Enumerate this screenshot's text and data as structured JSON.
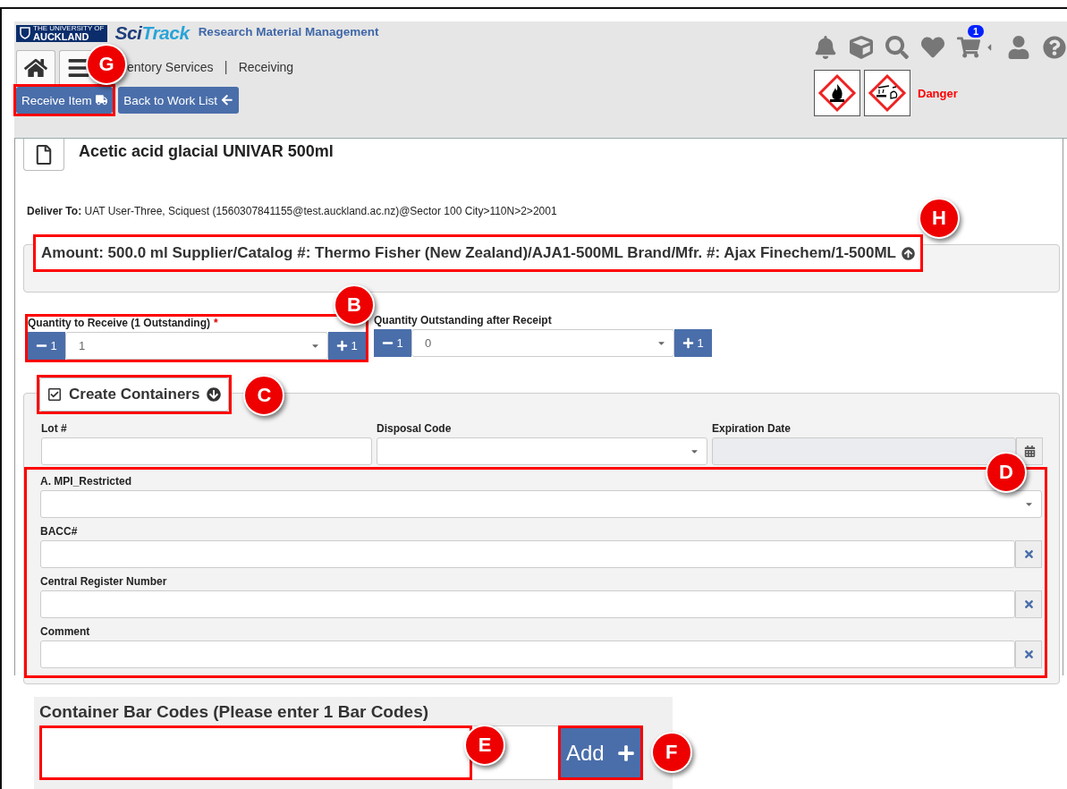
{
  "header": {
    "logo": {
      "line_1": "THE UNIVERSITY OF",
      "line_2": "AUCKLAND"
    },
    "brand": [
      "Sci",
      "Track"
    ],
    "app_title": "Research Material Management",
    "cart_count": "1",
    "breadcrumb": [
      "entory Services",
      "Receiving"
    ],
    "breadcrumb_separator": "|",
    "buttons": [
      {
        "label": "Receive Item",
        "kind": "receive",
        "callout": "G"
      },
      {
        "label": "Back to Work List",
        "kind": "back"
      }
    ],
    "hazard_signal": "Danger"
  },
  "item": {
    "title": "Acetic acid glacial UNIVAR 500ml",
    "deliver_to": "**Deliver To:** UAT User-Three, Sciquest (1560307841155@test.auckland.ac.nz)@Sector 100 City>110N>2>2001",
    "summary": "Amount: 500.0 ml Supplier/Catalog #: Thermo Fisher (New Zealand)/AJA1-500ML Brand/Mfr. #: Ajax Finechem/1-500ML",
    "summary_callout": "H"
  },
  "quantities": [
    {
      "label": "Quantity to Receive (1 Outstanding)",
      "required_mark": "*",
      "minus": "1",
      "value": "1",
      "plus": "1",
      "callout": "B"
    },
    {
      "label": "Quantity Outstanding after Receipt",
      "minus": "1",
      "value": "0",
      "plus": "1"
    }
  ],
  "containers": {
    "title": "Create Containers",
    "checked": true,
    "callout": "C",
    "fields": [
      {
        "label": "Lot #",
        "kind": "text"
      },
      {
        "label": "Disposal Code",
        "kind": "select"
      },
      {
        "label": "Expiration Date",
        "kind": "date",
        "disabled": true
      }
    ],
    "custom_callout": "D",
    "custom_fields": [
      {
        "label": "A. MPI_Restricted",
        "kind": "select"
      },
      {
        "label": "BACC#",
        "kind": "clearable"
      },
      {
        "label": "Central Register Number",
        "kind": "clearable"
      },
      {
        "label": "Comment",
        "kind": "clearable"
      }
    ]
  },
  "barcodes": {
    "title": "Container Bar Codes (Please enter 1 Bar Codes)",
    "input_callout": "E",
    "add_button": "Add",
    "add_callout": "F"
  }
}
